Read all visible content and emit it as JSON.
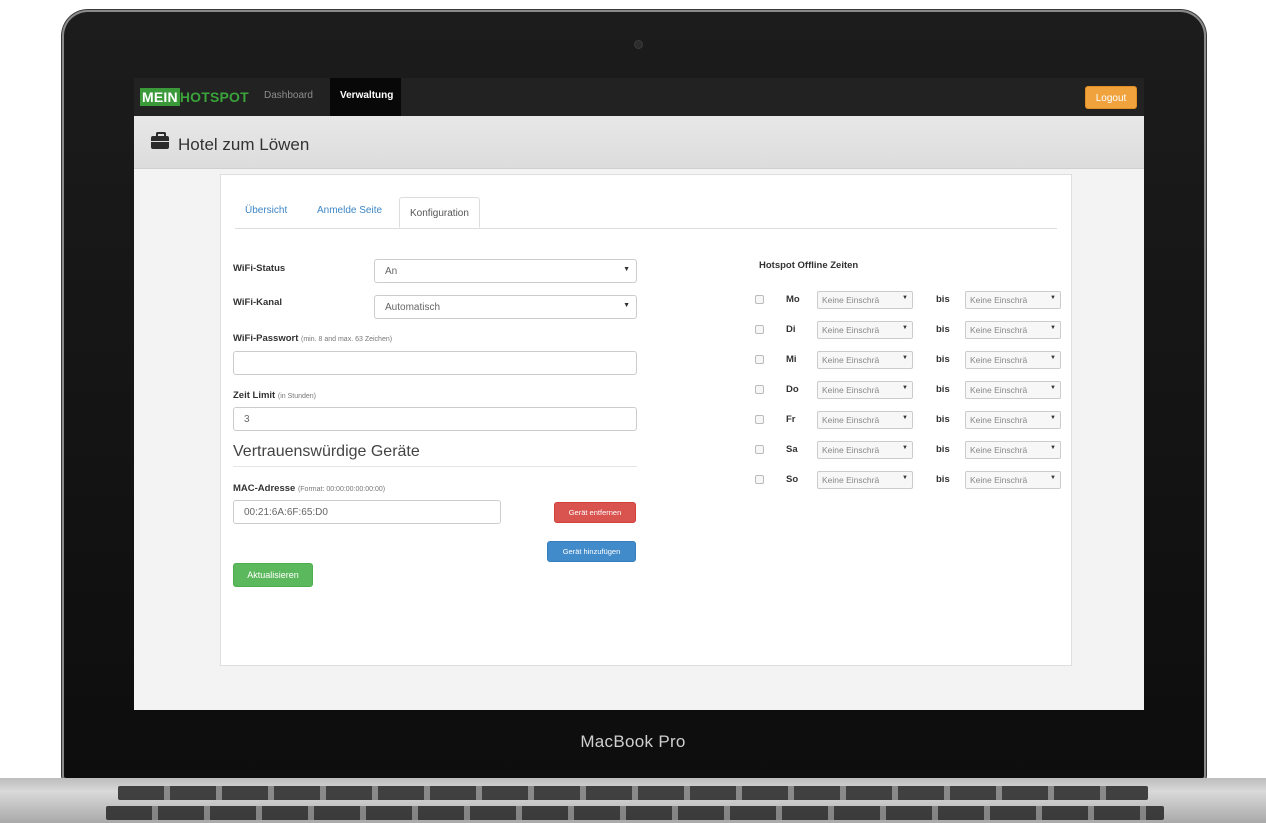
{
  "device": {
    "brand_label": "MacBook Pro"
  },
  "navbar": {
    "logo_part1": "MEIN",
    "logo_part2": "HOTSPOT",
    "items": [
      {
        "label": "Dashboard",
        "active": false
      },
      {
        "label": "Verwaltung",
        "active": true
      }
    ],
    "logout_label": "Logout"
  },
  "header": {
    "title": "Hotel zum Löwen",
    "icon": "briefcase-icon"
  },
  "tabs": [
    {
      "label": "Übersicht",
      "active": false
    },
    {
      "label": "Anmelde Seite",
      "active": false
    },
    {
      "label": "Konfiguration",
      "active": true
    }
  ],
  "form": {
    "wifi_status": {
      "label": "WiFi-Status",
      "value": "An"
    },
    "wifi_channel": {
      "label": "WiFi-Kanal",
      "value": "Automatisch"
    },
    "wifi_password": {
      "label": "WiFi-Passwort",
      "hint": "(min. 8 and max. 63 Zeichen)",
      "value": ""
    },
    "time_limit": {
      "label": "Zeit Limit",
      "hint": "(in Stunden)",
      "value": "3"
    },
    "trusted_devices_title": "Vertrauenswürdige Geräte",
    "mac": {
      "label": "MAC-Adresse",
      "hint": "(Format: 00:00:00:00:00:00)",
      "value": "00:21:6A:6F:65:D0"
    },
    "remove_device_label": "Gerät entfernen",
    "add_device_label": "Gerät hinzufügen",
    "update_label": "Aktualisieren"
  },
  "schedule": {
    "title": "Hotspot Offline Zeiten",
    "to_label": "bis",
    "days": [
      {
        "day": "Mo",
        "from": "Keine Einschrä",
        "to": "Keine Einschrä"
      },
      {
        "day": "Di",
        "from": "Keine Einschrä",
        "to": "Keine Einschrä"
      },
      {
        "day": "Mi",
        "from": "Keine Einschrä",
        "to": "Keine Einschrä"
      },
      {
        "day": "Do",
        "from": "Keine Einschrä",
        "to": "Keine Einschrä"
      },
      {
        "day": "Fr",
        "from": "Keine Einschrä",
        "to": "Keine Einschrä"
      },
      {
        "day": "Sa",
        "from": "Keine Einschrä",
        "to": "Keine Einschrä"
      },
      {
        "day": "So",
        "from": "Keine Einschrä",
        "to": "Keine Einschrä"
      }
    ]
  },
  "colors": {
    "navbar_bg": "#222222",
    "logo_green": "#3a9a3a",
    "logout_orange": "#f0a23c",
    "link_blue": "#3e86c6",
    "danger_red": "#d9534f",
    "primary_blue": "#428bca",
    "success_green": "#5cb85c"
  }
}
